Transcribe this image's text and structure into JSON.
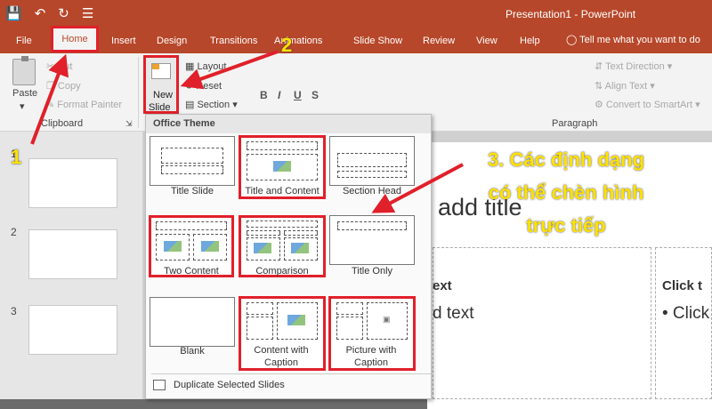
{
  "window": {
    "title": "Presentation1  -  PowerPoint"
  },
  "qat": {
    "save": "💾",
    "undo": "↶",
    "redo": "↻",
    "more": "☰"
  },
  "tabs": {
    "file": "File",
    "home": "Home",
    "insert": "Insert",
    "design": "Design",
    "transitions": "Transitions",
    "animations": "Animations",
    "slideshow": "Slide Show",
    "review": "Review",
    "view": "View",
    "help": "Help",
    "tellme": "Tell me what you want to do"
  },
  "ribbon": {
    "paste": "Paste",
    "cut": "Cut",
    "copy": "Copy",
    "format_painter": "Format Painter",
    "clipboard_group": "Clipboard",
    "new_slide_line1": "New",
    "new_slide_line2": "Slide",
    "layout": "Layout",
    "reset": "Reset",
    "section": "Section",
    "text_direction": "Text Direction",
    "align_text": "Align Text",
    "convert_smartart": "Convert to SmartArt",
    "paragraph_group": "Paragraph"
  },
  "menu": {
    "header": "Office Theme",
    "layouts": [
      {
        "name": "Title Slide"
      },
      {
        "name": "Title and Content"
      },
      {
        "name": "Section Head"
      },
      {
        "name": "Two Content"
      },
      {
        "name": "Comparison"
      },
      {
        "name": "Title Only"
      },
      {
        "name": "Blank"
      },
      {
        "name": "Content with",
        "name2": "Caption"
      },
      {
        "name": "Picture with",
        "name2": "Caption"
      }
    ],
    "duplicate": "Duplicate Selected Slides"
  },
  "thumbnails": {
    "n1": "1",
    "n2": "2",
    "n3": "3"
  },
  "slide": {
    "title": "add title",
    "text1": "ext",
    "text2": "d text",
    "click": "Click t",
    "click2": "• Click"
  },
  "annotations": {
    "one": "1",
    "two": "2",
    "three_line1": "3. Các định dạng",
    "three_line2": "có thể chèn hình",
    "three_line3": "trực tiếp"
  }
}
